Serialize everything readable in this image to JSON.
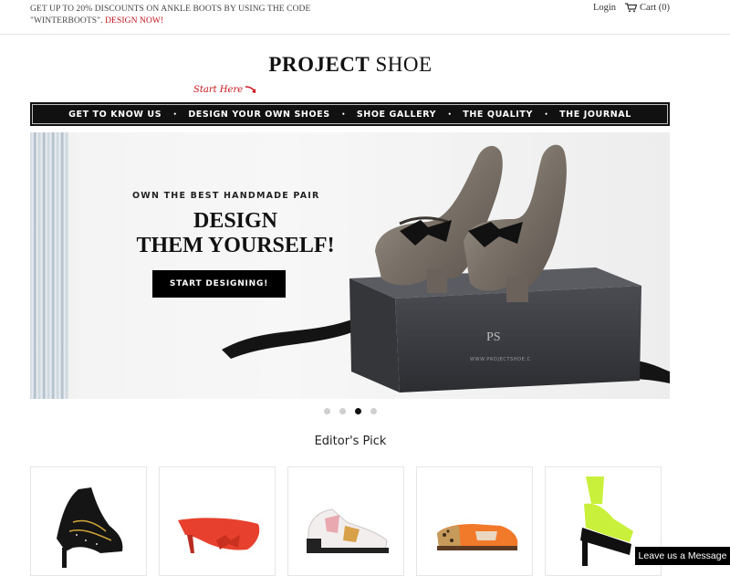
{
  "promo": {
    "line1": "GET UP TO 20% DISCOUNTS ON ANKLE BOOTS BY USING THE CODE",
    "line2": "\"WINTERBOOTS\".",
    "cta": "DESIGN NOW!"
  },
  "account": {
    "login": "Login",
    "cart": "Cart (0)",
    "cart_icon": "cart-icon"
  },
  "logo": {
    "bold": "PROJECT",
    "light": "SHOE"
  },
  "start_here": "Start Here",
  "nav": {
    "items": [
      "GET TO KNOW US",
      "DESIGN YOUR OWN SHOES",
      "SHOE GALLERY",
      "THE QUALITY",
      "THE JOURNAL"
    ]
  },
  "hero": {
    "kicker": "OWN THE BEST HANDMADE PAIR",
    "title_line1": "DESIGN",
    "title_line2": "THEM YOURSELF!",
    "button": "START DESIGNING!",
    "box_monogram": "PS",
    "box_url": "WWW.PROJECTSHOE.C"
  },
  "carousel": {
    "count": 4,
    "active_index": 2
  },
  "editors_pick": {
    "title": "Editor's Pick",
    "products": [
      {
        "name": "black-studded-ankle-boot",
        "color": "#1a1a1a"
      },
      {
        "name": "red-bow-pump",
        "color": "#e8402e"
      },
      {
        "name": "white-cutout-oxford",
        "color": "#f2f2f2"
      },
      {
        "name": "leopard-orange-cutout",
        "color": "#f07a2a"
      },
      {
        "name": "neon-platform-sandal",
        "color": "#c9f03a"
      }
    ]
  },
  "chat": {
    "label": "Leave us a Message"
  },
  "colors": {
    "accent_red": "#c0121b",
    "nav_bg": "#111111"
  }
}
